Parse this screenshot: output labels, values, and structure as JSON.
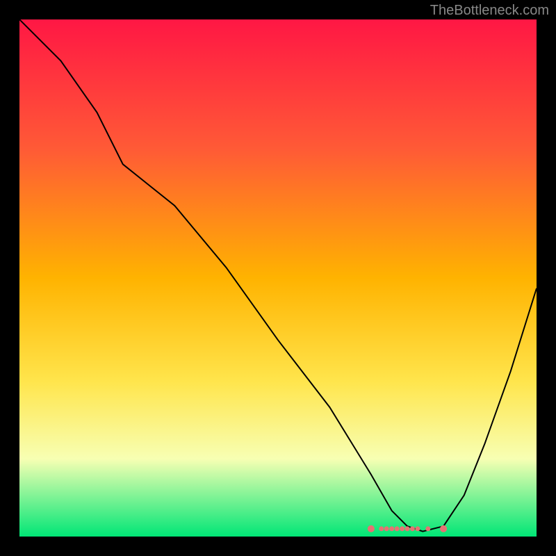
{
  "watermark": "TheBottleneck.com",
  "chart_data": {
    "type": "line",
    "title": "",
    "xlabel": "",
    "ylabel": "",
    "xlim": [
      0,
      100
    ],
    "ylim": [
      0,
      100
    ],
    "background_gradient": {
      "stops": [
        {
          "pos": 0,
          "color": "#ff1744"
        },
        {
          "pos": 25,
          "color": "#ff5a36"
        },
        {
          "pos": 50,
          "color": "#ffb300"
        },
        {
          "pos": 70,
          "color": "#ffe54c"
        },
        {
          "pos": 85,
          "color": "#f7ffb3"
        },
        {
          "pos": 100,
          "color": "#00e676"
        }
      ]
    },
    "series": [
      {
        "name": "bottleneck-curve",
        "color": "#000000",
        "x": [
          0,
          8,
          15,
          20,
          25,
          30,
          40,
          50,
          60,
          68,
          72,
          75,
          78,
          82,
          86,
          90,
          95,
          100
        ],
        "y": [
          100,
          92,
          82,
          72,
          68,
          64,
          52,
          38,
          25,
          12,
          5,
          2,
          1,
          2,
          8,
          18,
          32,
          48
        ]
      }
    ],
    "markers": {
      "name": "optimal-range",
      "color": "#e57373",
      "x": [
        68,
        70,
        71,
        72,
        73,
        74,
        75,
        76,
        77,
        79,
        82
      ],
      "y": [
        1.5,
        1.5,
        1.5,
        1.5,
        1.5,
        1.5,
        1.5,
        1.5,
        1.5,
        1.5,
        1.5
      ]
    }
  }
}
